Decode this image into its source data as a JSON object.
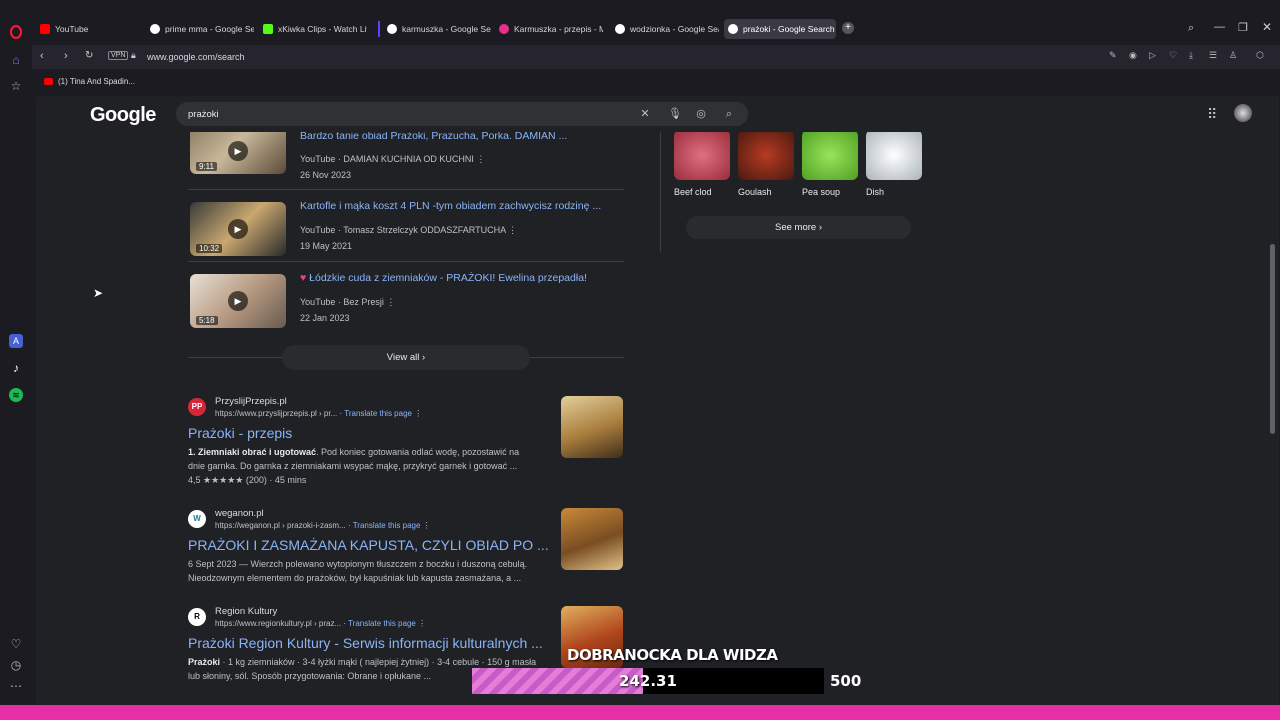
{
  "tabs": [
    {
      "label": "YouTube",
      "color": "#ff0000"
    },
    {
      "label": "prime mma - Google Sear",
      "color": "#ffffff"
    },
    {
      "label": "xKiwka Clips - Watch Live",
      "color": "#53fc18"
    },
    {
      "label": "karmuszka - Google Sear",
      "color": "#ffffff"
    },
    {
      "label": "Karmuszka - przepis - Mo",
      "color": "#e62e8a"
    },
    {
      "label": "wodzionka - Google Sear",
      "color": "#ffffff"
    },
    {
      "label": "prażoki - Google Search",
      "color": "#ffffff"
    }
  ],
  "address": {
    "vpn": "VPN",
    "url": "www.google.com/search"
  },
  "bookmarks": [
    {
      "label": "(1) Tina And Spadin..."
    }
  ],
  "google": {
    "logo": "Google",
    "query": "prażoki"
  },
  "videos": [
    {
      "title": "Bardzo tanie obiad Prażoki, Prazucha, Porka. DAMIAN ...",
      "source": "YouTube",
      "channel": "DAMIAN KUCHNIA OD KUCHNI",
      "date": "26 Nov 2023",
      "duration": "9:11"
    },
    {
      "title": "Kartofle i mąka koszt 4 PLN -tym obiadem zachwycisz rodzinę ...",
      "source": "YouTube",
      "channel": "Tomasz Strzelczyk ODDASZFARTUCHA",
      "date": "19 May 2021",
      "duration": "10:32"
    },
    {
      "title": "Łódzkie cuda z ziemniaków - PRAŻOKI! Ewelina przepadła!",
      "source": "YouTube",
      "channel": "Bez Presji",
      "date": "22 Jan 2023",
      "duration": "5:18"
    }
  ],
  "view_all": "View all",
  "results": [
    {
      "site": "PrzyslijPrzepis.pl",
      "url": "https://www.przyslijprzepis.pl › pr...",
      "translate": "Translate this page",
      "title": "Prażoki - przepis",
      "snippet_bold": "1. Ziemniaki obrać i ugotować",
      "snippet": ". Pod koniec gotowania odlać wodę, pozostawić na dnie garnka. Do garnka z ziemniakami wsypać mąkę, przykryć garnek i gotować ...",
      "rating": "4,5 ★★★★★ (200) · 45 mins",
      "fav": "PP"
    },
    {
      "site": "weganon.pl",
      "url": "https://weganon.pl › prazoki-i-zasm...",
      "translate": "Translate this page",
      "title": "PRAŻOKI I ZASMAŻANA KAPUSTA, CZYLI OBIAD PO ...",
      "snippet_bold": "",
      "snippet": "6 Sept 2023 — Wierzch polewano wytopionym tłuszczem z boczku i duszoną cebulą. Nieodzownym elementem do prażoków, był kapuśniak lub kapusta zasmażana, a ...",
      "rating": "",
      "fav": "W"
    },
    {
      "site": "Region Kultury",
      "url": "https://www.regionkultury.pl › praz...",
      "translate": "Translate this page",
      "title": "Prażoki Region Kultury - Serwis informacji kulturalnych ...",
      "snippet_bold": "Prażoki",
      "snippet": " · 1 kg ziemniaków · 3-4 łyżki mąki ( najlepiej żytniej) · 3-4 cebule · 150 g masła lub słoniny, sól. Sposób przygotowania: Obrane i opłukane ...",
      "rating": "",
      "fav": "R"
    }
  ],
  "knowledge": {
    "items": [
      {
        "label": "Beef clod",
        "color": "#c94a5a"
      },
      {
        "label": "Goulash",
        "color": "#8b2a1c"
      },
      {
        "label": "Pea soup",
        "color": "#6fc23c"
      },
      {
        "label": "Dish",
        "color": "#d8dde2"
      }
    ],
    "see_more": "See more"
  },
  "overlay": {
    "title": "DOBRANOCKA DLA WIDZA",
    "value": "242.31",
    "max": "500",
    "progress_fraction": 0.4846,
    "fill_color": "#e27ed8"
  }
}
